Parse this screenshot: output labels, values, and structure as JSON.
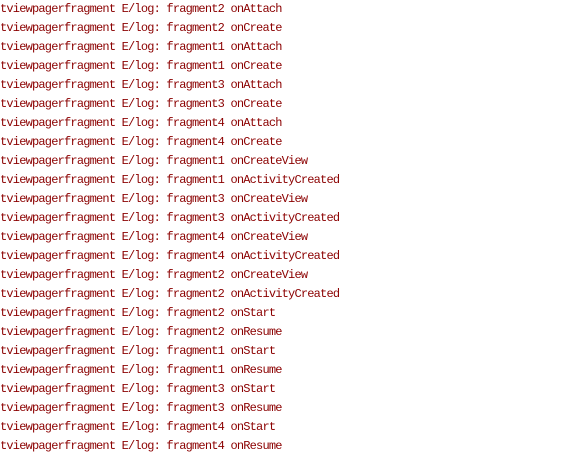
{
  "log": {
    "text_color": "#8b0000",
    "lines": [
      "tviewpagerfragment E/log: fragment2 onAttach",
      "tviewpagerfragment E/log: fragment2 onCreate",
      "tviewpagerfragment E/log: fragment1 onAttach",
      "tviewpagerfragment E/log: fragment1 onCreate",
      "tviewpagerfragment E/log: fragment3 onAttach",
      "tviewpagerfragment E/log: fragment3 onCreate",
      "tviewpagerfragment E/log: fragment4 onAttach",
      "tviewpagerfragment E/log: fragment4 onCreate",
      "tviewpagerfragment E/log: fragment1 onCreateView",
      "tviewpagerfragment E/log: fragment1 onActivityCreated",
      "tviewpagerfragment E/log: fragment3 onCreateView",
      "tviewpagerfragment E/log: fragment3 onActivityCreated",
      "tviewpagerfragment E/log: fragment4 onCreateView",
      "tviewpagerfragment E/log: fragment4 onActivityCreated",
      "tviewpagerfragment E/log: fragment2 onCreateView",
      "tviewpagerfragment E/log: fragment2 onActivityCreated",
      "tviewpagerfragment E/log: fragment2 onStart",
      "tviewpagerfragment E/log: fragment2 onResume",
      "tviewpagerfragment E/log: fragment1 onStart",
      "tviewpagerfragment E/log: fragment1 onResume",
      "tviewpagerfragment E/log: fragment3 onStart",
      "tviewpagerfragment E/log: fragment3 onResume",
      "tviewpagerfragment E/log: fragment4 onStart",
      "tviewpagerfragment E/log: fragment4 onResume"
    ]
  }
}
